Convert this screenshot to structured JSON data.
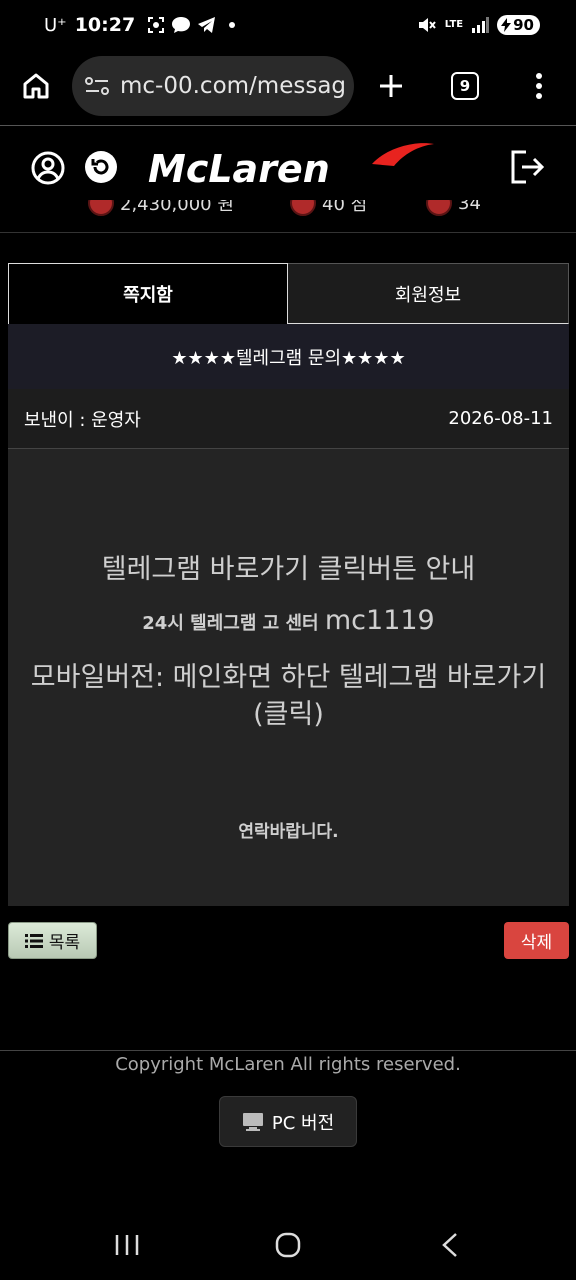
{
  "status_bar": {
    "carrier": "U⁺",
    "time": "10:27",
    "network": "LTE",
    "battery": "90"
  },
  "browser": {
    "url": "mc-00.com/messag",
    "tab_count": "9"
  },
  "site": {
    "logo_text": "McLaren",
    "peek_values": [
      "2,430,000 원",
      "40 점",
      "34"
    ]
  },
  "tabs": [
    {
      "label": "쪽지함",
      "active": true
    },
    {
      "label": "회원정보",
      "active": false
    }
  ],
  "message": {
    "title": "★★★★텔레그램 문의★★★★",
    "sender": "보낸이 : 운영자",
    "date": "2026-08-11",
    "body": {
      "line1": "텔레그램 바로가기 클릭버튼 안내",
      "line2_prefix": "24시 텔레그램 고   센터 ",
      "line2_id": "mc1119",
      "line3": "모바일버전: 메인화면 하단 텔레그램 바로가기 (클릭)",
      "line4": "연락바랍니다."
    }
  },
  "actions": {
    "list_label": "목록",
    "delete_label": "삭제"
  },
  "footer": {
    "copyright": "Copyright McLaren All rights reserved.",
    "pc_version_label": "PC 버전"
  },
  "colors": {
    "accent_red": "#d9453f",
    "logo_red": "#e8231f",
    "tab_border": "#dddddd"
  },
  "icons": [
    "home-icon",
    "site-settings-icon",
    "plus-icon",
    "more-icon",
    "user-icon",
    "refresh-icon",
    "logout-icon",
    "list-icon",
    "monitor-icon"
  ]
}
